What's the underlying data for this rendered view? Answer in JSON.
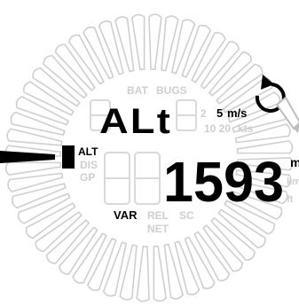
{
  "display": {
    "upper_labels": {
      "bat": "BAT",
      "bugs": "BUGS"
    },
    "mode_text": "ALt",
    "vario_scale": {
      "ms_value": "5",
      "ms_unit": "m/s",
      "kts_values": "10 20",
      "kts_unit": "kts",
      "ghost_digit": "2"
    },
    "pointer_label": "ALT",
    "left_labels": {
      "dis": "DIS",
      "gp": "GP"
    },
    "main_value": "1593",
    "units": {
      "m": "m",
      "km": "km",
      "ft": "ft"
    },
    "bottom_labels": {
      "var": "VAR",
      "rel": "REL",
      "sc": "SC",
      "net": "NET"
    },
    "icons": [
      "rotate-arrow-icon",
      "pencil-icon",
      "needle-pointer-icon"
    ],
    "colors": {
      "active": "#000000",
      "inactive": "#d2d2d2",
      "background": "#ffffff"
    }
  }
}
